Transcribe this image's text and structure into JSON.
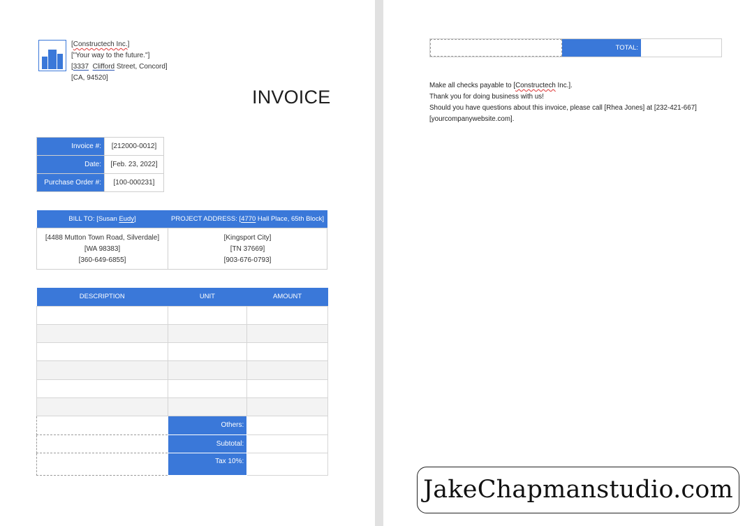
{
  "company": {
    "name": "Constructech Inc.",
    "tagline": "\"Your way to the future.\"",
    "street_number": "3337",
    "street_name": "Clifford",
    "street_suffix": "Street, Concord",
    "city_zip": "CA, 94520"
  },
  "title": "INVOICE",
  "meta": {
    "invoice_label": "Invoice #:",
    "invoice_value": "[212000-0012]",
    "date_label": "Date:",
    "date_value": "[Feb. 23, 2022]",
    "po_label": "Purchase Order #:",
    "po_value": "[100-000231]"
  },
  "bill_to": {
    "header_prefix": "BILL TO: [Susan ",
    "header_name": "Eudy",
    "header_suffix": "]",
    "address": "[4488 Mutton Town Road, Silverdale]",
    "state_zip": "[WA 98383]",
    "phone": "[360-649-6855]"
  },
  "project": {
    "header_prefix": "PROJECT ADDRESS: [",
    "header_number": "4770",
    "header_suffix": "  Hall Place, 65th Block]",
    "city": "[Kingsport City]",
    "state_zip": "[TN 37669]",
    "phone": "[903-676-0793]"
  },
  "items": {
    "headers": {
      "description": "DESCRIPTION",
      "unit": "UNIT",
      "amount": "AMOUNT"
    },
    "others_label": "Others:",
    "subtotal_label": "Subtotal:",
    "tax_label": "Tax 10%:"
  },
  "total_label": "TOTAL:",
  "notes": {
    "checks_prefix": "Make all checks payable to [",
    "checks_company": "Constructech",
    "checks_suffix": " Inc.].",
    "thanks": "Thank you for doing business with us!",
    "questions": "Should you have questions about this invoice, please call [Rhea Jones] at [232-421-667]",
    "website": "[yourcompanywebsite.com]."
  },
  "watermark": "JakeChapmanstudio.com",
  "colors": {
    "accent": "#3a78d9"
  }
}
